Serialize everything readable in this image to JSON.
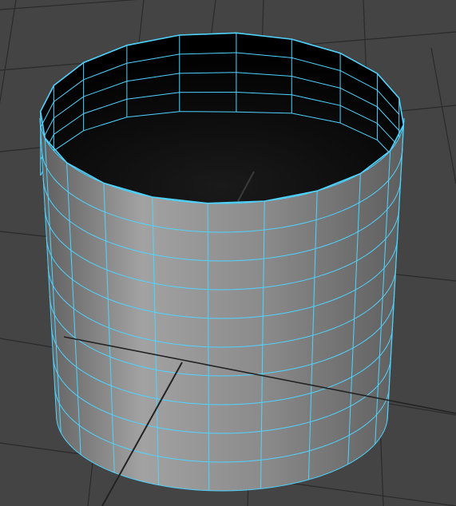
{
  "viewport": {
    "background_color": "#444444",
    "grid_color": "#2a2a2a",
    "shell_fill_color": "#8a8a8a",
    "shell_shade_color": "#5e5e5e",
    "shell_highlight_color": "#a2a2a2",
    "interior_color": "#000000",
    "wireframe_color": "#4fd4ff"
  },
  "mesh": {
    "object_type": "cylinder",
    "selection_state": "selected",
    "open_top": true,
    "display_mode": "wireframe-on-shaded"
  }
}
